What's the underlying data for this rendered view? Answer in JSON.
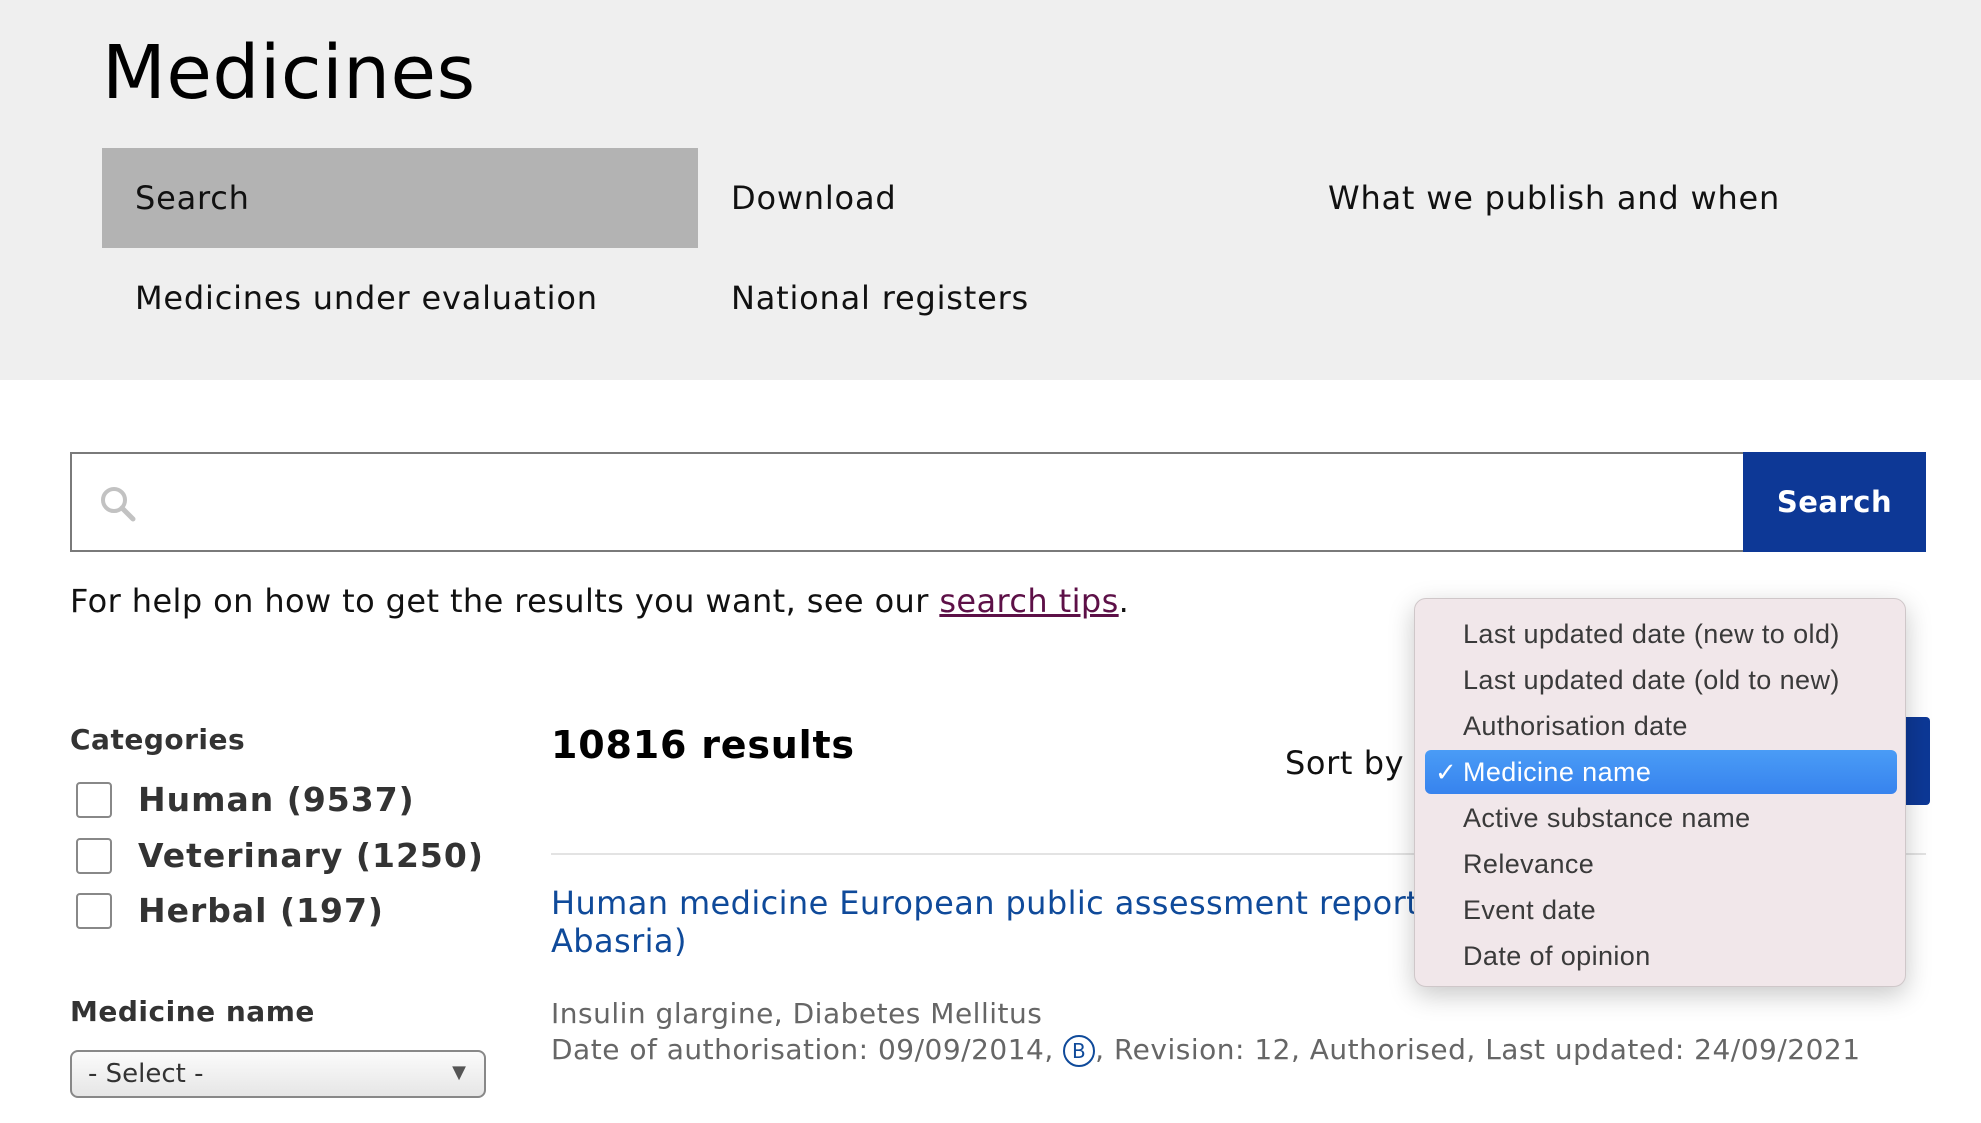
{
  "header": {
    "title": "Medicines",
    "nav": [
      {
        "label": "Search",
        "active": true
      },
      {
        "label": "Download",
        "active": false
      },
      {
        "label": "What we publish and when",
        "active": false
      },
      {
        "label": "Medicines under evaluation",
        "active": false
      },
      {
        "label": "National registers",
        "active": false
      }
    ]
  },
  "search": {
    "placeholder": "",
    "value": "",
    "button_label": "Search",
    "icon": "search-icon"
  },
  "help": {
    "prefix": "For help on how to get the results you want, see our ",
    "link_text": "search tips",
    "suffix": "."
  },
  "filters": {
    "categories_title": "Categories",
    "categories": [
      {
        "label": "Human (9537)",
        "checked": false
      },
      {
        "label": "Veterinary (1250)",
        "checked": false
      },
      {
        "label": "Herbal (197)",
        "checked": false
      }
    ],
    "medicine_name_title": "Medicine name",
    "medicine_name_select": "- Select -"
  },
  "results": {
    "count_label": "10816 results",
    "sort_label": "Sort by",
    "sort_options": [
      {
        "label": "Last updated date (new to old)",
        "selected": false
      },
      {
        "label": "Last updated date (old to new)",
        "selected": false
      },
      {
        "label": "Authorisation date",
        "selected": false
      },
      {
        "label": "Medicine name",
        "selected": true
      },
      {
        "label": "Active substance name",
        "selected": false
      },
      {
        "label": "Relevance",
        "selected": false
      },
      {
        "label": "Event date",
        "selected": false
      },
      {
        "label": "Date of opinion",
        "selected": false
      }
    ],
    "items": [
      {
        "title_line1": "Human medicine European public assessment report (",
        "title_line2": "Abasria)",
        "meta_line1": "Insulin glargine, Diabetes Mellitus",
        "meta_prefix": "Date of authorisation: 09/09/2014, ",
        "badge": "B",
        "meta_suffix": ", Revision: 12, Authorised, Last updated: 24/09/2021"
      }
    ]
  },
  "colors": {
    "header_bg": "#efefef",
    "nav_active_bg": "#b3b3b3",
    "primary_button": "#0d3896",
    "link_blue": "#0f4a9a",
    "link_visited": "#5d1047",
    "dropdown_selected": "#3783ee"
  }
}
